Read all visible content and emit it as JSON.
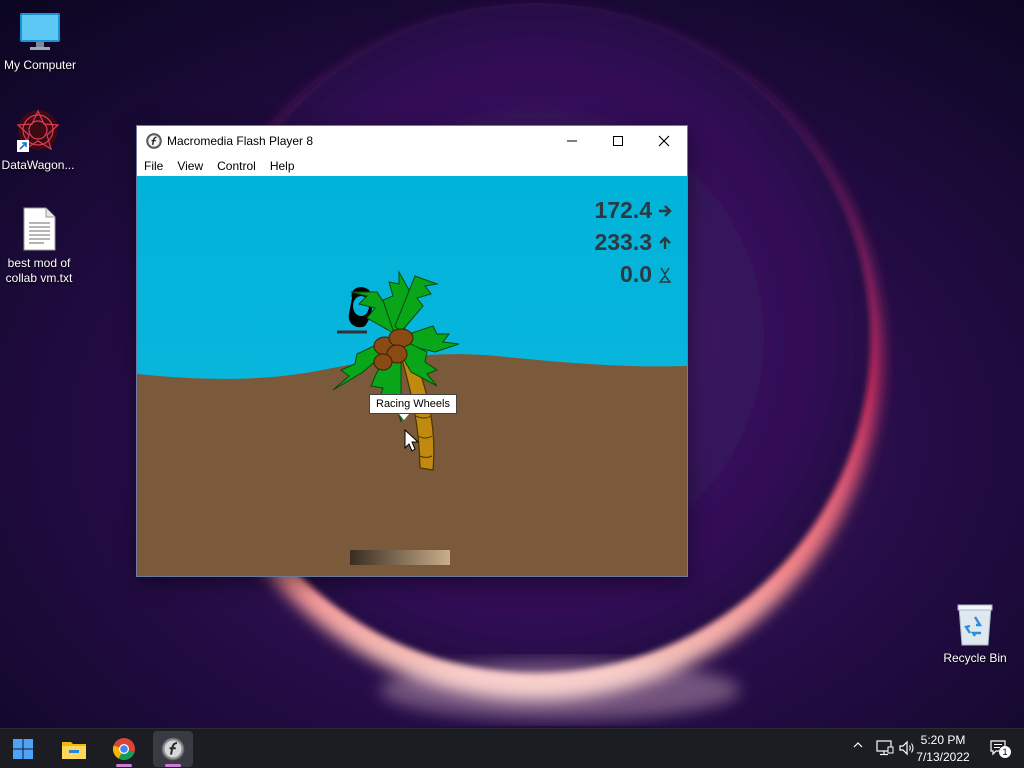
{
  "desktop": {
    "icons": [
      {
        "label": "My Computer"
      },
      {
        "label": "DataWagon..."
      },
      {
        "label": "best mod of collab vm.txt"
      },
      {
        "label": "Recycle Bin"
      }
    ]
  },
  "window": {
    "title": "Macromedia Flash Player 8",
    "menus": [
      "File",
      "View",
      "Control",
      "Help"
    ]
  },
  "game": {
    "stats": [
      {
        "value": "172.4",
        "icon": "arrow-right-icon"
      },
      {
        "value": "233.3",
        "icon": "arrow-up-icon"
      },
      {
        "value": "0.0",
        "icon": "tilt-icon"
      }
    ],
    "tooltip": "Racing Wheels",
    "colors": {
      "sky": "#00b3d9",
      "dirt": "#7a5a3a",
      "text": "#2a3a40"
    }
  },
  "taskbar": {
    "apps": [
      "start-icon",
      "file-explorer-icon",
      "chrome-icon",
      "flash-player-icon"
    ],
    "time": "5:20 PM",
    "date": "7/13/2022",
    "notification_count": "1"
  }
}
